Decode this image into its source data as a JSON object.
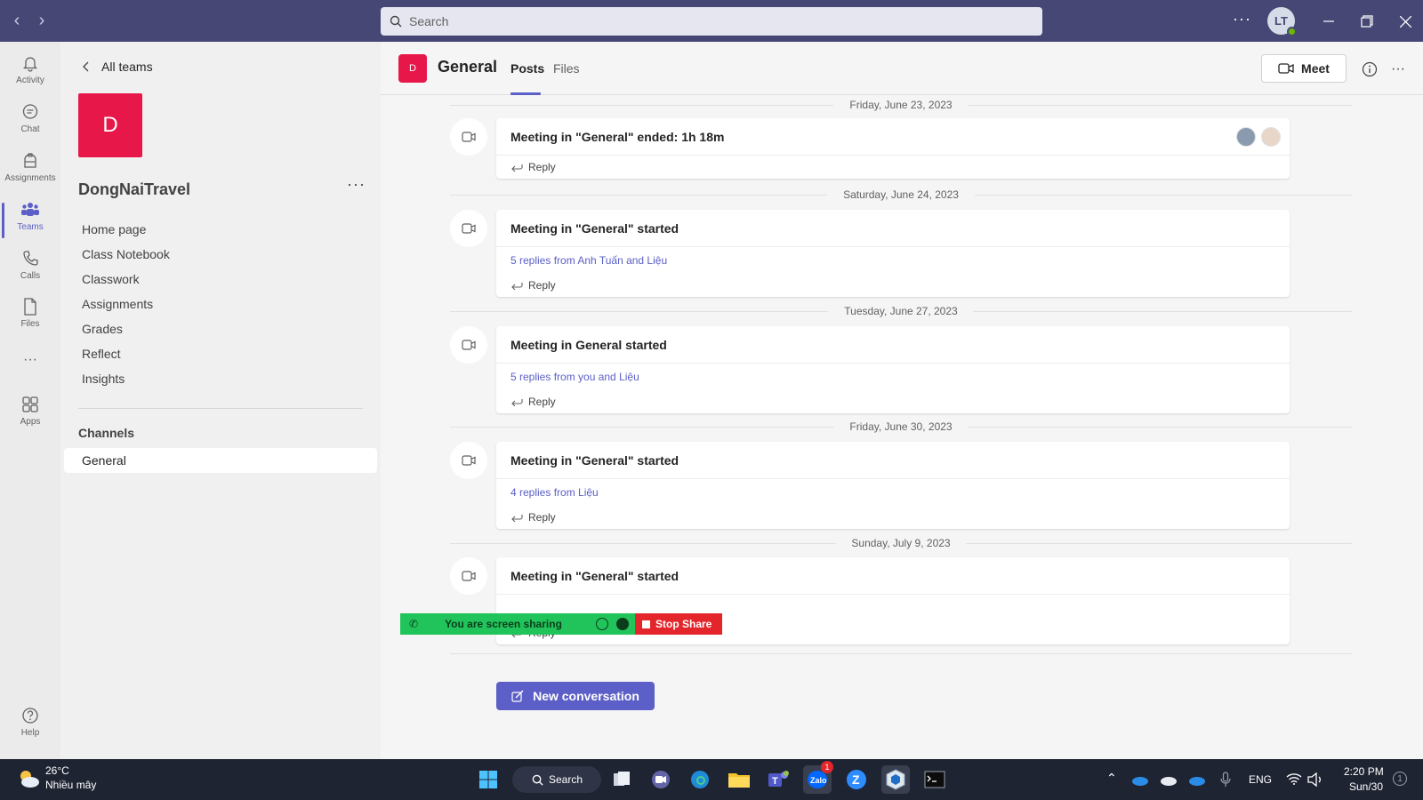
{
  "titlebar": {
    "search_placeholder": "Search",
    "user_initials": "LT"
  },
  "rail": {
    "items": [
      {
        "label": "Activity",
        "icon": "bell-icon"
      },
      {
        "label": "Chat",
        "icon": "chat-icon"
      },
      {
        "label": "Assignments",
        "icon": "assignments-icon"
      },
      {
        "label": "Teams",
        "icon": "teams-icon"
      },
      {
        "label": "Calls",
        "icon": "phone-icon"
      },
      {
        "label": "Files",
        "icon": "file-icon"
      },
      {
        "label": "Apps",
        "icon": "apps-icon"
      },
      {
        "label": "Help",
        "icon": "help-icon"
      }
    ]
  },
  "team": {
    "back_label": "All teams",
    "tile_letter": "D",
    "name": "DongNaiTravel",
    "links": [
      "Home page",
      "Class Notebook",
      "Classwork",
      "Assignments",
      "Grades",
      "Reflect",
      "Insights"
    ],
    "channels_heading": "Channels",
    "channels": [
      "General"
    ]
  },
  "channel": {
    "tile_letter": "D",
    "title": "General",
    "tabs": [
      "Posts",
      "Files"
    ],
    "meet_label": "Meet"
  },
  "posts": [
    {
      "date": "Friday, June 23, 2023",
      "title": "Meeting in \"General\" ended: 1h 18m",
      "replies": "",
      "reply_label": "Reply"
    },
    {
      "date": "Saturday, June 24, 2023",
      "title": "Meeting in \"General\" started",
      "replies": "5 replies from Anh Tuấn and Liệu",
      "reply_label": "Reply"
    },
    {
      "date": "Tuesday, June 27, 2023",
      "title": "Meeting in General started",
      "replies": "5 replies from you and Liệu",
      "reply_label": "Reply"
    },
    {
      "date": "Friday, June 30, 2023",
      "title": "Meeting in \"General\" started",
      "replies": "4 replies from Liệu",
      "reply_label": "Reply"
    },
    {
      "date": "Sunday, July 9, 2023",
      "title": "Meeting in \"General\" started",
      "replies": "",
      "reply_label": "Reply"
    }
  ],
  "new_conversation_label": "New conversation",
  "screen_share": {
    "status": "You are screen sharing",
    "stop_label": "Stop Share"
  },
  "taskbar": {
    "weather_temp": "26°C",
    "weather_desc": "Nhiều mây",
    "search_label": "Search",
    "zalo_badge": "1",
    "language": "ENG",
    "time": "2:20 PM",
    "date": "Sun/30",
    "notification_count": "1"
  },
  "colors": {
    "titlebar": "#464775",
    "accent": "#5b5fc7",
    "team_tile": "#e8174a",
    "share_green": "#21c45a",
    "stop_red": "#e3262b",
    "taskbar": "#1f2433"
  }
}
